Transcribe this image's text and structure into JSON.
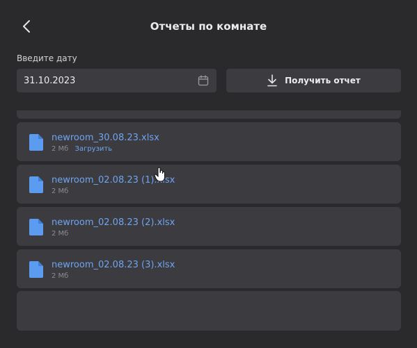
{
  "header": {
    "title": "Отчеты по комнате",
    "back_icon": "chevron-left-icon"
  },
  "form": {
    "date_label": "Введите дату",
    "date_value": "31.10.2023",
    "calendar_icon": "calendar-icon",
    "get_report_label": "Получить отчет",
    "download_icon": "download-icon"
  },
  "files": [
    {
      "name": "newroom_30.08.23.xlsx",
      "size": "2 Мб",
      "action": "Загрузить"
    },
    {
      "name": "newroom_02.08.23 (1).xlsx",
      "size": "2 Мб"
    },
    {
      "name": "newroom_02.08.23 (2).xlsx",
      "size": "2 Мб"
    },
    {
      "name": "newroom_02.08.23 (3).xlsx",
      "size": "2 Мб"
    }
  ],
  "colors": {
    "background": "#2a2a2d",
    "card": "#3c3c40",
    "link": "#6fa4ef",
    "file_icon": "#5b9cf0"
  }
}
